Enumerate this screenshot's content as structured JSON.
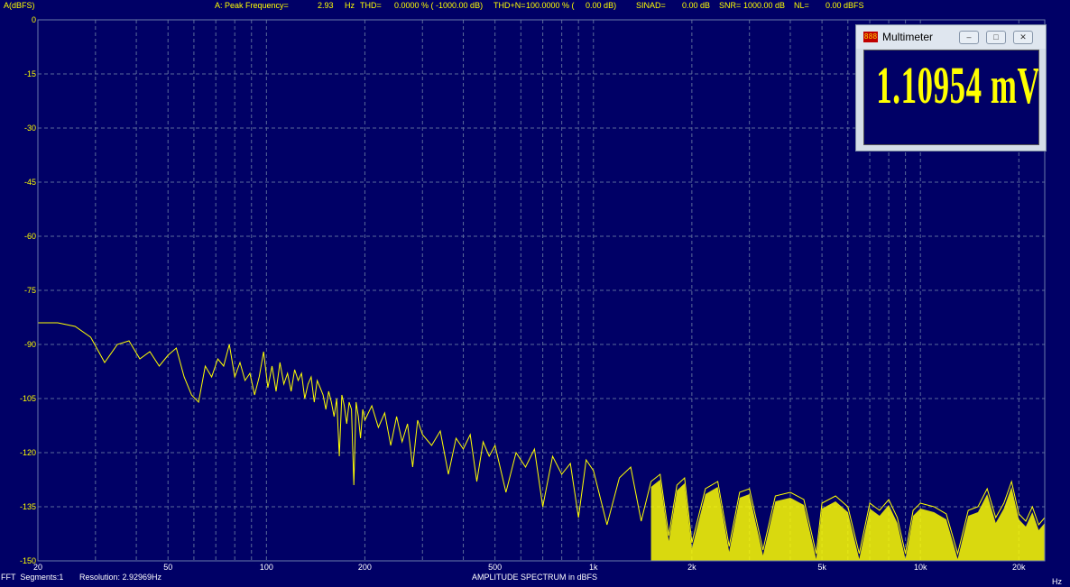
{
  "header": {
    "ylabel": "A(dBFS)",
    "peak_label": "A: Peak Frequency=",
    "peak_value": "2.93",
    "peak_unit": "Hz",
    "thd_label": "THD=",
    "thd_value": "0.0000 % ( -1000.00 dB)",
    "thdn_label": "THD+N=",
    "thdn_value": "100.0000 % (     0.00 dB)",
    "sinad_label": "SINAD=",
    "sinad_value": "0.00 dB",
    "snr_label": "SNR=",
    "snr_value": "1000.00 dB",
    "nl_label": "NL=",
    "nl_value": "0.00 dBFS"
  },
  "footer": {
    "segments": "FFT  Segments:1",
    "resolution": "Resolution: 2.92969Hz",
    "xlabel": "AMPLITUDE SPECTRUM in dBFS",
    "xunit": "Hz"
  },
  "multimeter": {
    "title": "Multimeter",
    "icon_text": "888",
    "value": "1.10954 mV",
    "minimize": "‒",
    "maximize": "□",
    "close": "✕"
  },
  "colors": {
    "background": "#000066",
    "trace": "#ffff00",
    "grid": "#5a6a9a",
    "axis_text": "#ffff00",
    "footer_text": "#ffffff"
  },
  "chart_data": {
    "type": "line",
    "title": "",
    "xlabel": "AMPLITUDE SPECTRUM in dBFS",
    "ylabel": "A(dBFS)",
    "x_scale": "log",
    "xlim": [
      20,
      24000
    ],
    "ylim": [
      -150,
      0
    ],
    "y_ticks": [
      0,
      -15,
      -30,
      -45,
      -60,
      -75,
      -90,
      -105,
      -120,
      -135,
      -150
    ],
    "x_tick_labels": [
      {
        "value": 20,
        "label": "20"
      },
      {
        "value": 50,
        "label": "50"
      },
      {
        "value": 100,
        "label": "100"
      },
      {
        "value": 200,
        "label": "200"
      },
      {
        "value": 500,
        "label": "500"
      },
      {
        "value": 1000,
        "label": "1k"
      },
      {
        "value": 2000,
        "label": "2k"
      },
      {
        "value": 5000,
        "label": "5k"
      },
      {
        "value": 10000,
        "label": "10k"
      },
      {
        "value": 20000,
        "label": "20k"
      }
    ],
    "grid": true,
    "series": [
      {
        "x": [
          20,
          23,
          26,
          29,
          32,
          35,
          38,
          41,
          44,
          47,
          50,
          53,
          56,
          59,
          62,
          65,
          68,
          71,
          74,
          77,
          80,
          83,
          86,
          89,
          92,
          95,
          98,
          101,
          104,
          107,
          110,
          113,
          116,
          119,
          122,
          125,
          128,
          131,
          134,
          137,
          140,
          143,
          146,
          149,
          152,
          155,
          158,
          161,
          164,
          167,
          170,
          173,
          176,
          179,
          182,
          185,
          188,
          191,
          194,
          197,
          200,
          210,
          220,
          230,
          240,
          250,
          260,
          270,
          280,
          290,
          300,
          320,
          340,
          360,
          380,
          400,
          420,
          440,
          460,
          480,
          500,
          540,
          580,
          620,
          660,
          700,
          750,
          800,
          850,
          900,
          950,
          1000,
          1100,
          1200,
          1300,
          1400,
          1500,
          1600,
          1700,
          1800,
          1900,
          2000,
          2200,
          2400,
          2600,
          2800,
          3000,
          3300,
          3600,
          4000,
          4400,
          4800,
          5000,
          5500,
          6000,
          6500,
          7000,
          7500,
          8000,
          8500,
          9000,
          9500,
          10000,
          11000,
          12000,
          13000,
          14000,
          15000,
          16000,
          17000,
          18000,
          19000,
          20000,
          21000,
          22000,
          23000,
          24000
        ],
        "y": [
          -84,
          -84,
          -85,
          -88,
          -95,
          -90,
          -89,
          -94,
          -92,
          -96,
          -93,
          -91,
          -99,
          -104,
          -106,
          -96,
          -99,
          -94,
          -96,
          -90,
          -99,
          -95,
          -100,
          -98,
          -104,
          -99,
          -92,
          -102,
          -96,
          -103,
          -95,
          -101,
          -98,
          -103,
          -97,
          -100,
          -98,
          -105,
          -101,
          -99,
          -106,
          -100,
          -102,
          -104,
          -108,
          -103,
          -106,
          -110,
          -105,
          -121,
          -104,
          -107,
          -112,
          -106,
          -108,
          -129,
          -106,
          -110,
          -116,
          -108,
          -111,
          -107,
          -113,
          -109,
          -118,
          -110,
          -117,
          -112,
          -124,
          -111,
          -115,
          -118,
          -114,
          -126,
          -116,
          -119,
          -115,
          -128,
          -117,
          -121,
          -118,
          -131,
          -120,
          -124,
          -119,
          -135,
          -121,
          -126,
          -123,
          -138,
          -122,
          -125,
          -140,
          -127,
          -124,
          -139,
          -128,
          -126,
          -143,
          -129,
          -127,
          -145,
          -130,
          -128,
          -146,
          -131,
          -130,
          -147,
          -132,
          -131,
          -133,
          -148,
          -134,
          -132,
          -135,
          -148,
          -134,
          -136,
          -133,
          -138,
          -148,
          -136,
          -134,
          -135,
          -137,
          -148,
          -136,
          -135,
          -130,
          -138,
          -134,
          -128,
          -137,
          -139,
          -135,
          -140,
          -138
        ]
      }
    ]
  }
}
